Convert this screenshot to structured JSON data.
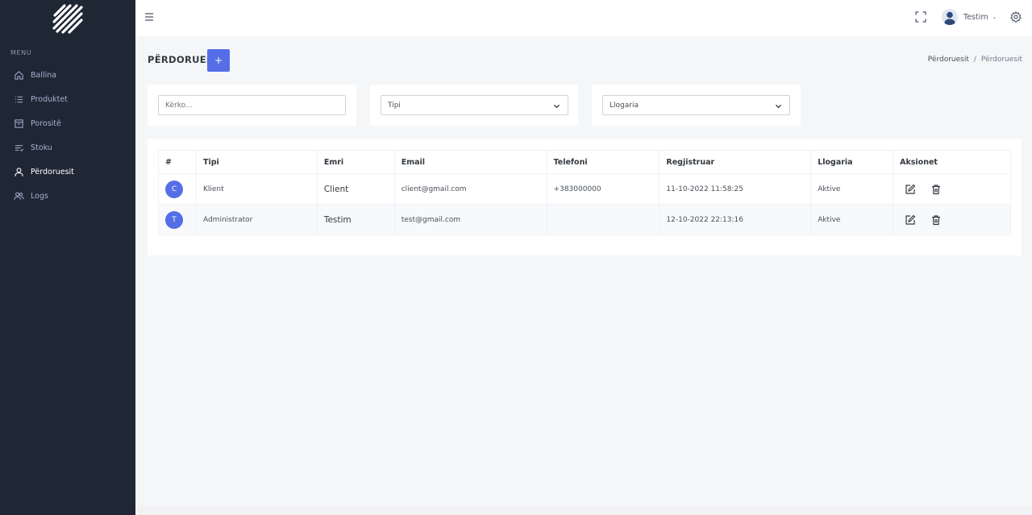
{
  "sidebar": {
    "menu_title": "MENU",
    "items": [
      {
        "label": "Ballina",
        "icon": "home-icon"
      },
      {
        "label": "Produktet",
        "icon": "list-icon"
      },
      {
        "label": "Porositë",
        "icon": "box-icon"
      },
      {
        "label": "Stoku",
        "icon": "stock-icon"
      },
      {
        "label": "Përdoruesit",
        "icon": "user-icon",
        "active": true
      },
      {
        "label": "Logs",
        "icon": "users-icon"
      }
    ]
  },
  "topbar": {
    "user_name": "Testim"
  },
  "page": {
    "title": "PËRDORUESIT",
    "add_label": "+",
    "breadcrumb": [
      "Përdoruesit",
      "Përdoruesit"
    ],
    "breadcrumb_sep": "/"
  },
  "filters": {
    "search_placeholder": "Kërko...",
    "type_select": "Tipi",
    "account_select": "Llogaria"
  },
  "table": {
    "headers": [
      "#",
      "Tipi",
      "Emri",
      "Email",
      "Telefoni",
      "Regjistruar",
      "Llogaria",
      "Aksionet"
    ],
    "rows": [
      {
        "initial": "C",
        "tipi": "Klient",
        "emri": "Client",
        "email": "client@gmail.com",
        "telefoni": "+383000000",
        "regjistruar": "11-10-2022 11:58:25",
        "llogaria": "Aktive"
      },
      {
        "initial": "T",
        "tipi": "Administrator",
        "emri": "Testim",
        "email": "test@gmail.com",
        "telefoni": "",
        "regjistruar": "12-10-2022 22:13:16",
        "llogaria": "Aktive"
      }
    ]
  },
  "colors": {
    "sidebar_bg": "#1f2735",
    "accent": "#556ee6"
  }
}
